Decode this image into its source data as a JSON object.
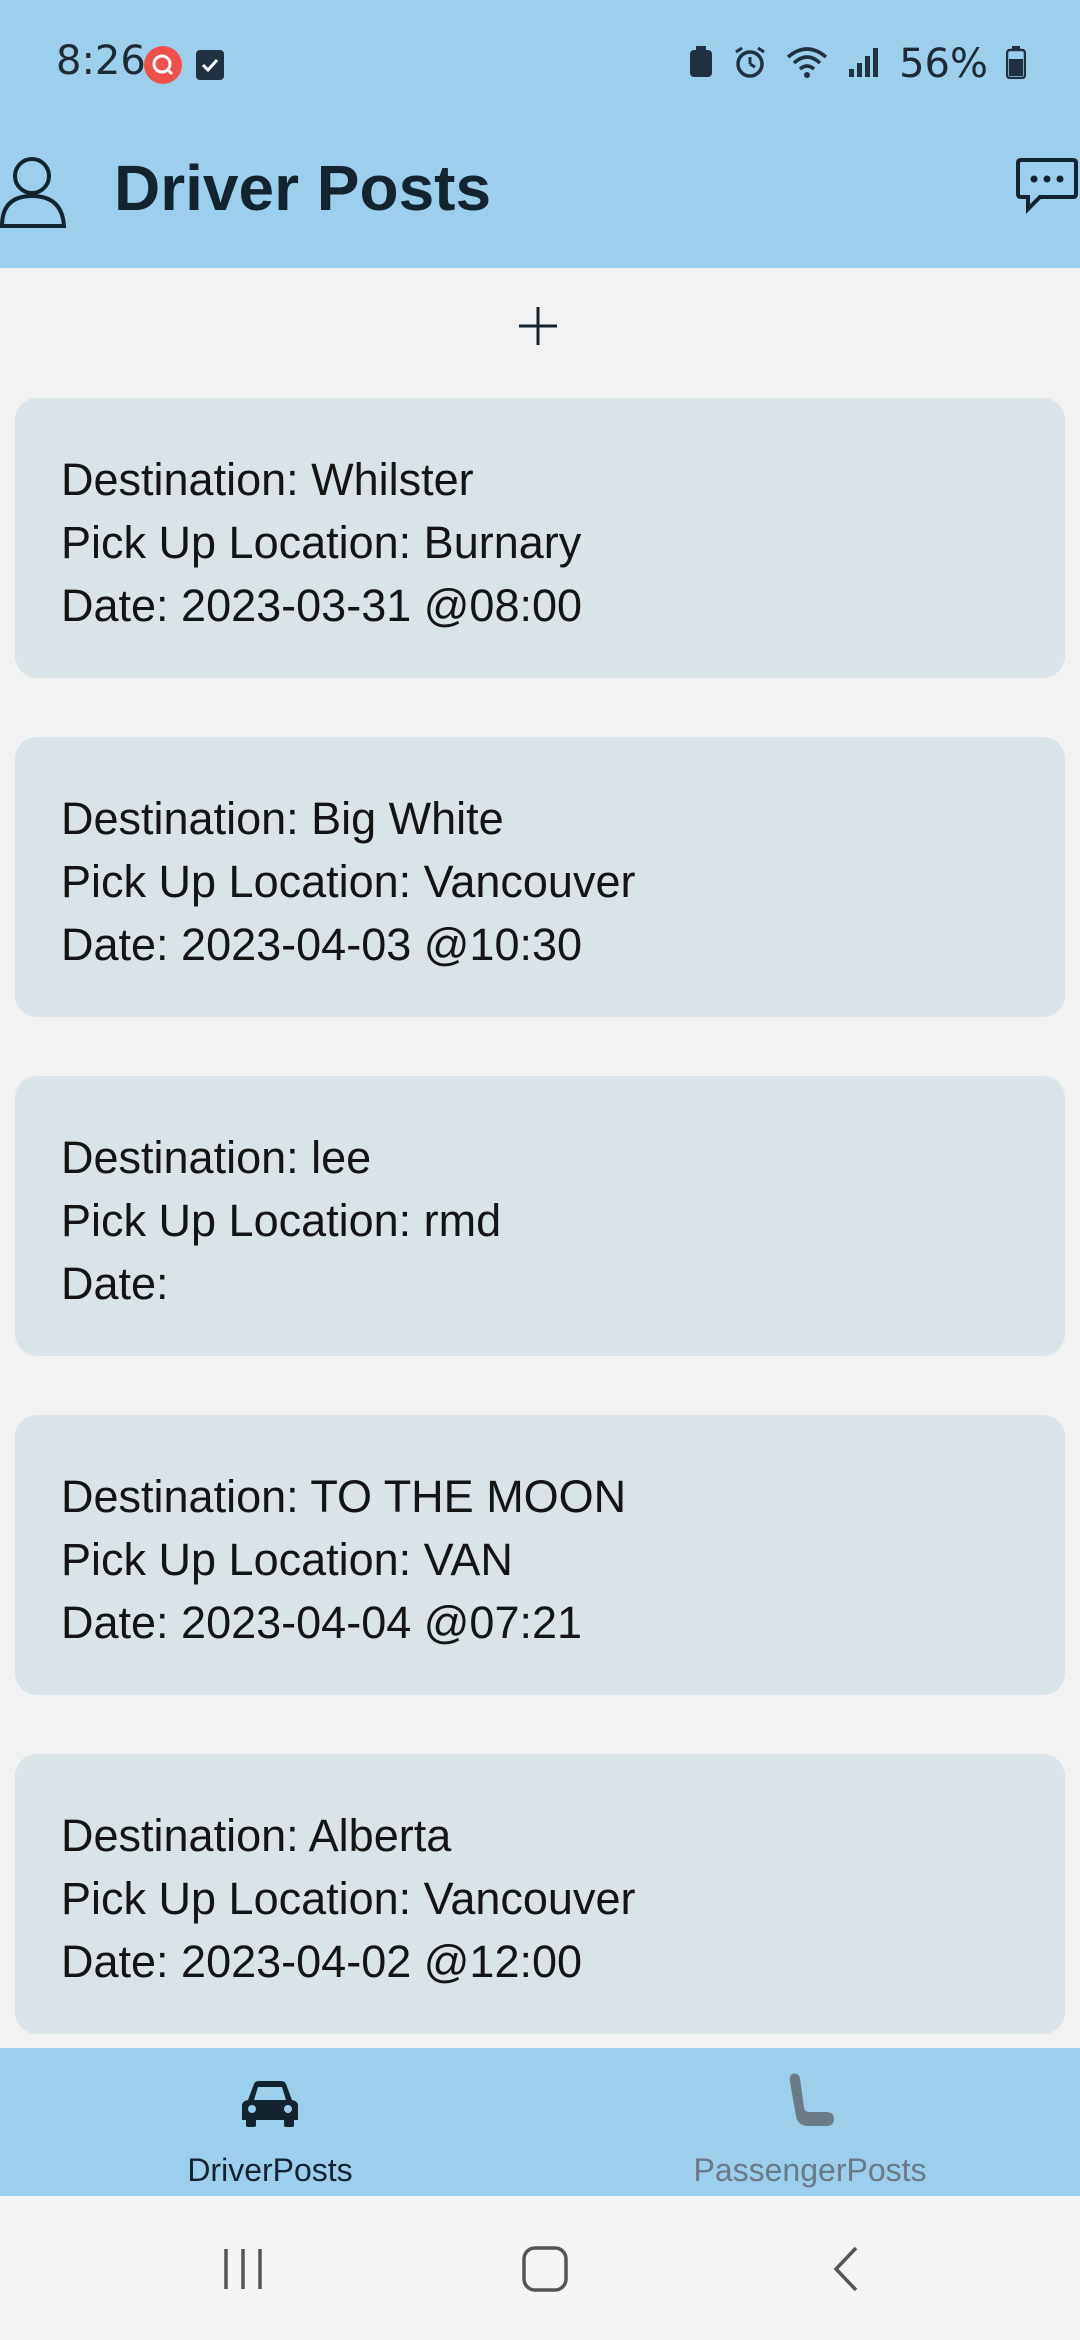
{
  "status_bar": {
    "time": "8:26",
    "battery_percent": "56%",
    "notification_icons": [
      "search-icon",
      "checkbox-icon"
    ],
    "system_icons": [
      "battery-saver-icon",
      "alarm-icon",
      "wifi-icon",
      "signal-icon",
      "battery-icon"
    ]
  },
  "header": {
    "title": "Driver Posts",
    "left_icon": "profile-icon",
    "right_icon": "chat-icon"
  },
  "actions": {
    "add_icon": "plus-icon"
  },
  "posts": [
    {
      "destination": "Destination: Whilster",
      "pickup": "Pick Up Location: Burnary",
      "date": "Date: 2023-03-31 @08:00"
    },
    {
      "destination": "Destination: Big White",
      "pickup": "Pick Up Location: Vancouver",
      "date": "Date: 2023-04-03 @10:30"
    },
    {
      "destination": "Destination: lee",
      "pickup": "Pick Up Location: rmd",
      "date": "Date:"
    },
    {
      "destination": "Destination: TO THE MOON",
      "pickup": "Pick Up Location: VAN",
      "date": "Date: 2023-04-04 @07:21"
    },
    {
      "destination": "Destination: Alberta",
      "pickup": "Pick Up Location: Vancouver",
      "date": "Date: 2023-04-02 @12:00"
    }
  ],
  "bottom_nav": {
    "items": [
      {
        "label": "DriverPosts",
        "icon": "car-icon",
        "active": true
      },
      {
        "label": "PassengerPosts",
        "icon": "seat-icon",
        "active": false
      }
    ]
  },
  "colors": {
    "bar_background": "#9bcfec",
    "card_background": "#d9e3e8",
    "page_background": "#f2f2f2",
    "title_text": "#14242f",
    "inactive_nav": "#6b7a85"
  }
}
